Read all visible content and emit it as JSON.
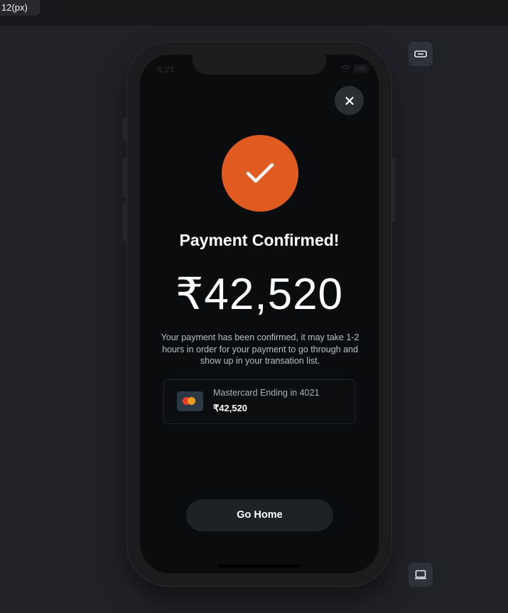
{
  "toolbar": {
    "size_label": "12(px)"
  },
  "status_bar": {
    "time": "8:23"
  },
  "confirmation": {
    "title": "Payment Confirmed!",
    "amount": "₹42,520",
    "description": "Your payment has been confirmed, it may take 1-2 hours in order for your payment to go through and show up in your transation list."
  },
  "card": {
    "label": "Mastercard Ending in 4021",
    "amount": "₹42,520"
  },
  "actions": {
    "go_home_label": "Go Home"
  },
  "colors": {
    "accent": "#e05b1f",
    "background": "#0a0d10"
  }
}
